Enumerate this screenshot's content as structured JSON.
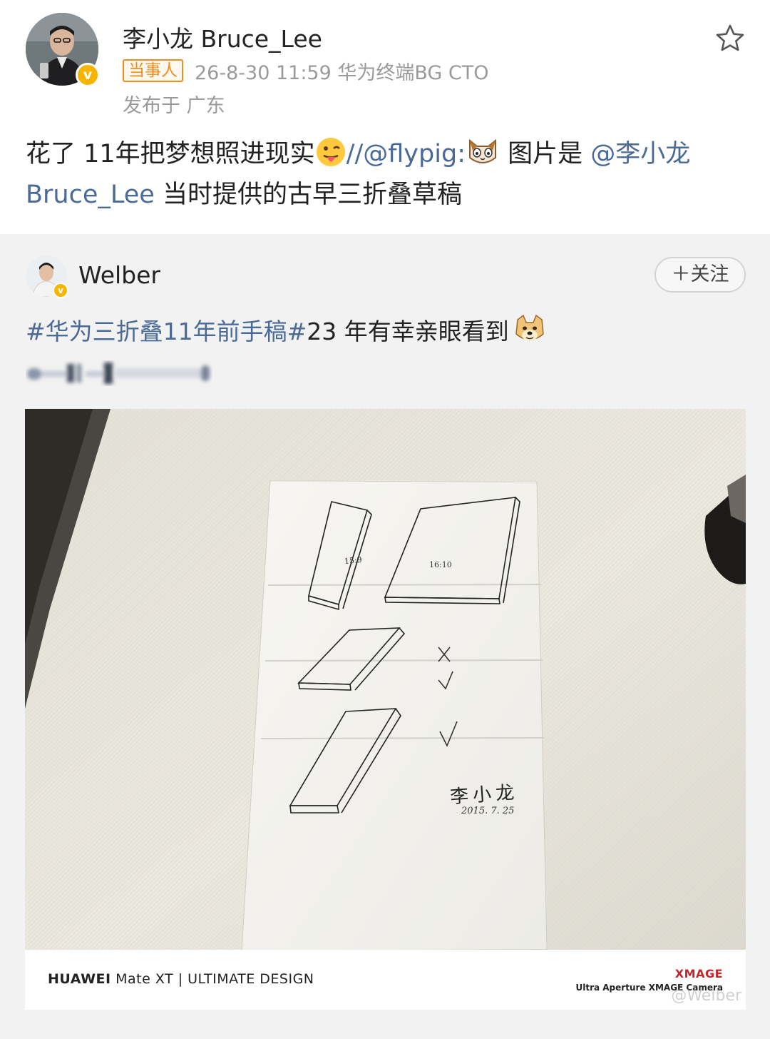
{
  "post": {
    "author": "李小龙 Bruce_Lee",
    "badge": "当事人",
    "meta": "26-8-30 11:59  华为终端BG CTO",
    "location": "发布于 广东",
    "text_part1": "花了 11年把梦想照进现实",
    "text_part2": "//",
    "mention1": "@flypig",
    "text_part3": ":",
    "text_part4": " 图片是 ",
    "mention2": "@李小龙 Bruce_Lee",
    "text_part5": " 当时提供的古早三折叠草稿"
  },
  "repost": {
    "author": "Welber",
    "follow_label": "＋关注",
    "topic": "#华为三折叠11年前手稿#",
    "text": "23 年有幸亲眼看到",
    "photo": {
      "sketch_label_1": "15:9",
      "sketch_label_2": "16:10",
      "signature": "李小龙",
      "date": "2015. 7. 25",
      "caption_brand": "HUAWEI",
      "caption_model": " Mate XT | ULTIMATE DESIGN",
      "xmage": "XMAGE",
      "xmage_sub": "Ultra Aperture XMAGE Camera",
      "watermark": "@Welber"
    }
  },
  "colors": {
    "link": "#4a6a97",
    "badge": "#f08d1f",
    "verified": "#f6b500",
    "xmage": "#c0282d"
  },
  "icons": [
    "avatar",
    "verified-icon",
    "star-icon",
    "tongue-emoji",
    "cat-emoji",
    "doge-emoji"
  ]
}
